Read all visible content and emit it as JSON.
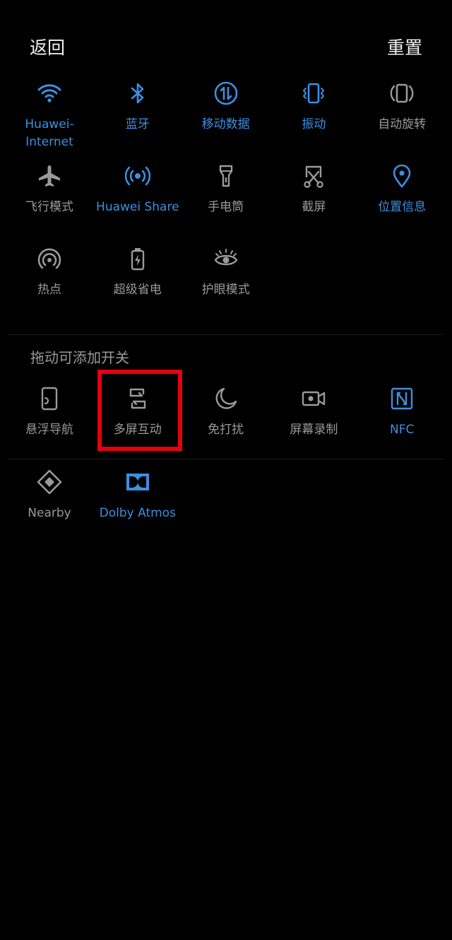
{
  "header": {
    "back": "返回",
    "reset": "重置"
  },
  "active_tiles": [
    {
      "label": "Huawei-\nInternet",
      "icon": "wifi-icon",
      "on": true
    },
    {
      "label": "蓝牙",
      "icon": "bluetooth-icon",
      "on": true
    },
    {
      "label": "移动数据",
      "icon": "mobile-data-icon",
      "on": true
    },
    {
      "label": "振动",
      "icon": "vibrate-icon",
      "on": true
    },
    {
      "label": "自动旋转",
      "icon": "auto-rotate-icon",
      "on": false
    },
    {
      "label": "飞行模式",
      "icon": "airplane-icon",
      "on": false
    },
    {
      "label": "Huawei Share",
      "icon": "huawei-share-icon",
      "on": true
    },
    {
      "label": "手电筒",
      "icon": "flashlight-icon",
      "on": false
    },
    {
      "label": "截屏",
      "icon": "screenshot-icon",
      "on": false
    },
    {
      "label": "位置信息",
      "icon": "location-icon",
      "on": true
    },
    {
      "label": "热点",
      "icon": "hotspot-icon",
      "on": false
    },
    {
      "label": "超级省电",
      "icon": "power-saver-icon",
      "on": false
    },
    {
      "label": "护眼模式",
      "icon": "eye-comfort-icon",
      "on": false
    }
  ],
  "available_section": {
    "hint": "拖动可添加开关"
  },
  "available_tiles": [
    {
      "label": "悬浮导航",
      "icon": "floating-nav-icon",
      "on": false
    },
    {
      "label": "多屏互动",
      "icon": "multi-screen-icon",
      "on": false
    },
    {
      "label": "免打扰",
      "icon": "moon-icon",
      "on": false
    },
    {
      "label": "屏幕录制",
      "icon": "screen-record-icon",
      "on": false
    },
    {
      "label": "NFC",
      "icon": "nfc-icon",
      "on": true
    },
    {
      "label": "Nearby",
      "icon": "nearby-icon",
      "on": false
    },
    {
      "label": "Dolby Atmos",
      "icon": "dolby-icon",
      "on": true
    }
  ],
  "colors": {
    "active": "#3d8fe0",
    "inactive": "#9a9a9a",
    "highlight": "#e3000f"
  }
}
